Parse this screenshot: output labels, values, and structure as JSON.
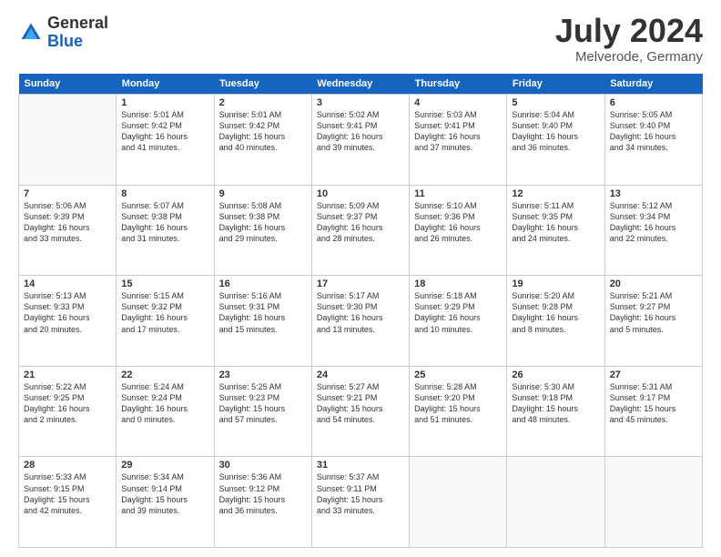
{
  "header": {
    "logo_line1": "General",
    "logo_line2": "Blue",
    "month": "July 2024",
    "location": "Melverode, Germany"
  },
  "days_of_week": [
    "Sunday",
    "Monday",
    "Tuesday",
    "Wednesday",
    "Thursday",
    "Friday",
    "Saturday"
  ],
  "weeks": [
    [
      {
        "num": "",
        "info": ""
      },
      {
        "num": "1",
        "info": "Sunrise: 5:01 AM\nSunset: 9:42 PM\nDaylight: 16 hours\nand 41 minutes."
      },
      {
        "num": "2",
        "info": "Sunrise: 5:01 AM\nSunset: 9:42 PM\nDaylight: 16 hours\nand 40 minutes."
      },
      {
        "num": "3",
        "info": "Sunrise: 5:02 AM\nSunset: 9:41 PM\nDaylight: 16 hours\nand 39 minutes."
      },
      {
        "num": "4",
        "info": "Sunrise: 5:03 AM\nSunset: 9:41 PM\nDaylight: 16 hours\nand 37 minutes."
      },
      {
        "num": "5",
        "info": "Sunrise: 5:04 AM\nSunset: 9:40 PM\nDaylight: 16 hours\nand 36 minutes."
      },
      {
        "num": "6",
        "info": "Sunrise: 5:05 AM\nSunset: 9:40 PM\nDaylight: 16 hours\nand 34 minutes."
      }
    ],
    [
      {
        "num": "7",
        "info": "Sunrise: 5:06 AM\nSunset: 9:39 PM\nDaylight: 16 hours\nand 33 minutes."
      },
      {
        "num": "8",
        "info": "Sunrise: 5:07 AM\nSunset: 9:38 PM\nDaylight: 16 hours\nand 31 minutes."
      },
      {
        "num": "9",
        "info": "Sunrise: 5:08 AM\nSunset: 9:38 PM\nDaylight: 16 hours\nand 29 minutes."
      },
      {
        "num": "10",
        "info": "Sunrise: 5:09 AM\nSunset: 9:37 PM\nDaylight: 16 hours\nand 28 minutes."
      },
      {
        "num": "11",
        "info": "Sunrise: 5:10 AM\nSunset: 9:36 PM\nDaylight: 16 hours\nand 26 minutes."
      },
      {
        "num": "12",
        "info": "Sunrise: 5:11 AM\nSunset: 9:35 PM\nDaylight: 16 hours\nand 24 minutes."
      },
      {
        "num": "13",
        "info": "Sunrise: 5:12 AM\nSunset: 9:34 PM\nDaylight: 16 hours\nand 22 minutes."
      }
    ],
    [
      {
        "num": "14",
        "info": "Sunrise: 5:13 AM\nSunset: 9:33 PM\nDaylight: 16 hours\nand 20 minutes."
      },
      {
        "num": "15",
        "info": "Sunrise: 5:15 AM\nSunset: 9:32 PM\nDaylight: 16 hours\nand 17 minutes."
      },
      {
        "num": "16",
        "info": "Sunrise: 5:16 AM\nSunset: 9:31 PM\nDaylight: 16 hours\nand 15 minutes."
      },
      {
        "num": "17",
        "info": "Sunrise: 5:17 AM\nSunset: 9:30 PM\nDaylight: 16 hours\nand 13 minutes."
      },
      {
        "num": "18",
        "info": "Sunrise: 5:18 AM\nSunset: 9:29 PM\nDaylight: 16 hours\nand 10 minutes."
      },
      {
        "num": "19",
        "info": "Sunrise: 5:20 AM\nSunset: 9:28 PM\nDaylight: 16 hours\nand 8 minutes."
      },
      {
        "num": "20",
        "info": "Sunrise: 5:21 AM\nSunset: 9:27 PM\nDaylight: 16 hours\nand 5 minutes."
      }
    ],
    [
      {
        "num": "21",
        "info": "Sunrise: 5:22 AM\nSunset: 9:25 PM\nDaylight: 16 hours\nand 2 minutes."
      },
      {
        "num": "22",
        "info": "Sunrise: 5:24 AM\nSunset: 9:24 PM\nDaylight: 16 hours\nand 0 minutes."
      },
      {
        "num": "23",
        "info": "Sunrise: 5:25 AM\nSunset: 9:23 PM\nDaylight: 15 hours\nand 57 minutes."
      },
      {
        "num": "24",
        "info": "Sunrise: 5:27 AM\nSunset: 9:21 PM\nDaylight: 15 hours\nand 54 minutes."
      },
      {
        "num": "25",
        "info": "Sunrise: 5:28 AM\nSunset: 9:20 PM\nDaylight: 15 hours\nand 51 minutes."
      },
      {
        "num": "26",
        "info": "Sunrise: 5:30 AM\nSunset: 9:18 PM\nDaylight: 15 hours\nand 48 minutes."
      },
      {
        "num": "27",
        "info": "Sunrise: 5:31 AM\nSunset: 9:17 PM\nDaylight: 15 hours\nand 45 minutes."
      }
    ],
    [
      {
        "num": "28",
        "info": "Sunrise: 5:33 AM\nSunset: 9:15 PM\nDaylight: 15 hours\nand 42 minutes."
      },
      {
        "num": "29",
        "info": "Sunrise: 5:34 AM\nSunset: 9:14 PM\nDaylight: 15 hours\nand 39 minutes."
      },
      {
        "num": "30",
        "info": "Sunrise: 5:36 AM\nSunset: 9:12 PM\nDaylight: 15 hours\nand 36 minutes."
      },
      {
        "num": "31",
        "info": "Sunrise: 5:37 AM\nSunset: 9:11 PM\nDaylight: 15 hours\nand 33 minutes."
      },
      {
        "num": "",
        "info": ""
      },
      {
        "num": "",
        "info": ""
      },
      {
        "num": "",
        "info": ""
      }
    ]
  ]
}
